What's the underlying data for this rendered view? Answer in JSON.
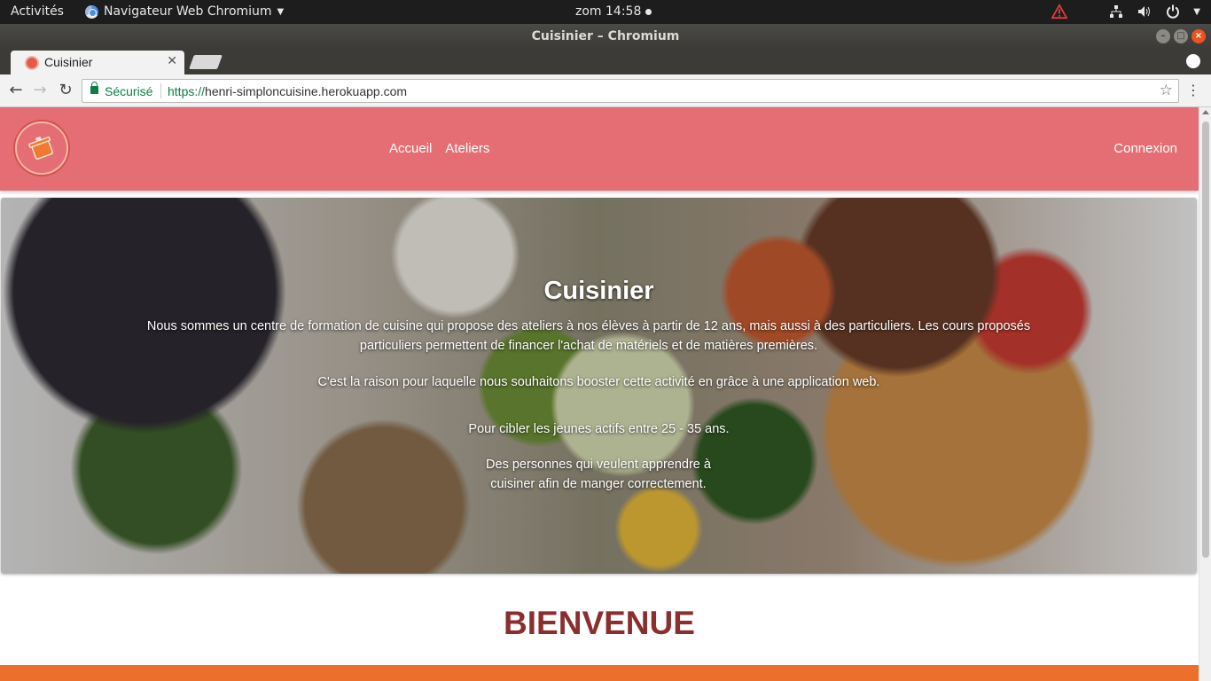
{
  "system_bar": {
    "activities": "Activités",
    "app_menu": "Navigateur Web Chromium",
    "clock": "zom 14:58"
  },
  "window": {
    "title": "Cuisinier – Chromium"
  },
  "tab": {
    "title": "Cuisinier"
  },
  "toolbar": {
    "secure_label": "Sécurisé",
    "url_scheme": "https://",
    "url_host": "henri-simploncuisine.herokuapp.com"
  },
  "site": {
    "nav": {
      "links": [
        "Accueil",
        "Ateliers"
      ],
      "login": "Connexion"
    },
    "hero": {
      "title": "Cuisinier",
      "paragraph1": "Nous sommes un centre de formation de cuisine qui propose des ateliers à nos élèves à partir de 12 ans, mais aussi à des particuliers. Les cours proposés particuliers permettent de financer l'achat de matériels et de matières premières.",
      "paragraph2": "C'est la raison pour laquelle nous souhaitons booster cette activité en grâce à une application web.",
      "paragraph3": "Pour cibler les jeunes actifs entre 25 - 35 ans.",
      "paragraph4": "Des personnes qui veulent apprendre à cuisiner afin de manger correctement."
    },
    "welcome": "BIENVENUE"
  },
  "colors": {
    "nav_bg": "#e46e73",
    "welcome_text": "#8b2e2e",
    "orange_band": "#ec6f2c",
    "secure_green": "#0b8043"
  }
}
